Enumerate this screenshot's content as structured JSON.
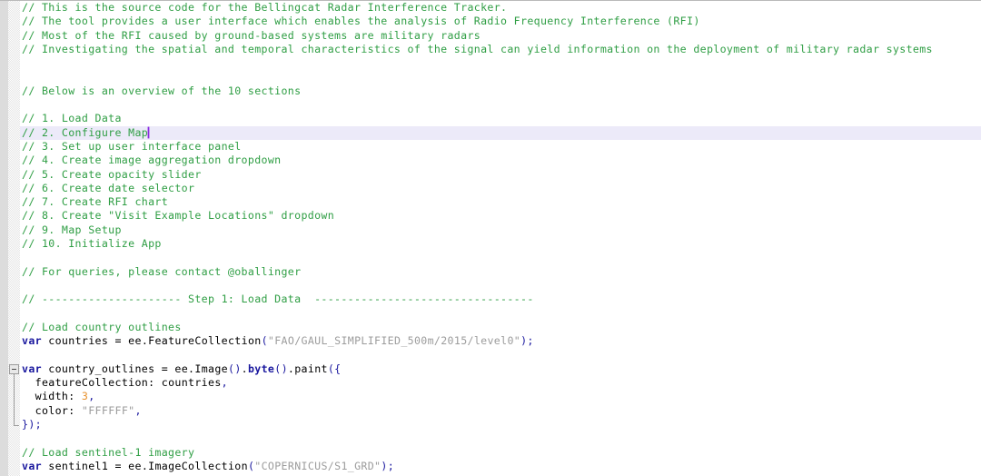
{
  "editor": {
    "name": "code-editor",
    "theme": {
      "background": "#ffffff",
      "active_line": "#eceaf9",
      "comment": "#2f9e44",
      "keyword": "#19179e",
      "string": "#9c9c9c",
      "number": "#e8912d",
      "caret": "#8a2be2",
      "gutter": "#dcdcdc"
    },
    "cursor": {
      "line_index": 9,
      "column_after_text": "// 2. Configure Map"
    }
  },
  "lines": [
    {
      "i": 0,
      "text": "// This is the source code for the Bellingcat Radar Interference Tracker.",
      "type": "comment"
    },
    {
      "i": 1,
      "text": "// The tool provides a user interface which enables the analysis of Radio Frequency Interference (RFI)",
      "type": "comment"
    },
    {
      "i": 2,
      "text": "// Most of the RFI caused by ground-based systems are military radars",
      "type": "comment"
    },
    {
      "i": 3,
      "text": "// Investigating the spatial and temporal characteristics of the signal can yield information on the deployment of military radar systems",
      "type": "comment"
    },
    {
      "i": 4,
      "text": "",
      "type": "blank"
    },
    {
      "i": 5,
      "text": "",
      "type": "blank"
    },
    {
      "i": 6,
      "text": "// Below is an overview of the 10 sections",
      "type": "comment"
    },
    {
      "i": 7,
      "text": "",
      "type": "blank"
    },
    {
      "i": 8,
      "text": "// 1. Load Data",
      "type": "comment"
    },
    {
      "i": 9,
      "text": "// 2. Configure Map",
      "type": "comment",
      "active": true
    },
    {
      "i": 10,
      "text": "// 3. Set up user interface panel",
      "type": "comment"
    },
    {
      "i": 11,
      "text": "// 4. Create image aggregation dropdown",
      "type": "comment"
    },
    {
      "i": 12,
      "text": "// 5. Create opacity slider",
      "type": "comment"
    },
    {
      "i": 13,
      "text": "// 6. Create date selector",
      "type": "comment"
    },
    {
      "i": 14,
      "text": "// 7. Create RFI chart",
      "type": "comment"
    },
    {
      "i": 15,
      "text": "// 8. Create \"Visit Example Locations\" dropdown",
      "type": "comment"
    },
    {
      "i": 16,
      "text": "// 9. Map Setup",
      "type": "comment"
    },
    {
      "i": 17,
      "text": "// 10. Initialize App",
      "type": "comment"
    },
    {
      "i": 18,
      "text": "",
      "type": "blank"
    },
    {
      "i": 19,
      "text": "// For queries, please contact @oballinger",
      "type": "comment"
    },
    {
      "i": 20,
      "text": "",
      "type": "blank"
    },
    {
      "i": 21,
      "text": "// --------------------- Step 1: Load Data  ---------------------------------",
      "type": "comment"
    },
    {
      "i": 22,
      "text": "",
      "type": "blank"
    },
    {
      "i": 23,
      "text": "// Load country outlines",
      "type": "comment"
    },
    {
      "i": 24,
      "text": "var countries = ee.FeatureCollection(\"FAO/GAUL_SIMPLIFIED_500m/2015/level0\");",
      "type": "code"
    },
    {
      "i": 25,
      "text": "",
      "type": "blank"
    },
    {
      "i": 26,
      "text": "var country_outlines = ee.Image().byte().paint({",
      "type": "code",
      "fold_start": true
    },
    {
      "i": 27,
      "text": "  featureCollection: countries,",
      "type": "code"
    },
    {
      "i": 28,
      "text": "  width: 3,",
      "type": "code"
    },
    {
      "i": 29,
      "text": "  color: \"FFFFFF\",",
      "type": "code"
    },
    {
      "i": 30,
      "text": "});",
      "type": "code",
      "fold_end": true
    },
    {
      "i": 31,
      "text": "",
      "type": "blank"
    },
    {
      "i": 32,
      "text": "// Load sentinel-1 imagery",
      "type": "comment"
    },
    {
      "i": 33,
      "text": "var sentinel1 = ee.ImageCollection(\"COPERNICUS/S1_GRD\");",
      "type": "code"
    }
  ],
  "fold_widget": {
    "name": "fold-collapse-widget",
    "state": "expanded",
    "glyph": "minus",
    "start_line_index": 26,
    "end_line_index": 30
  }
}
